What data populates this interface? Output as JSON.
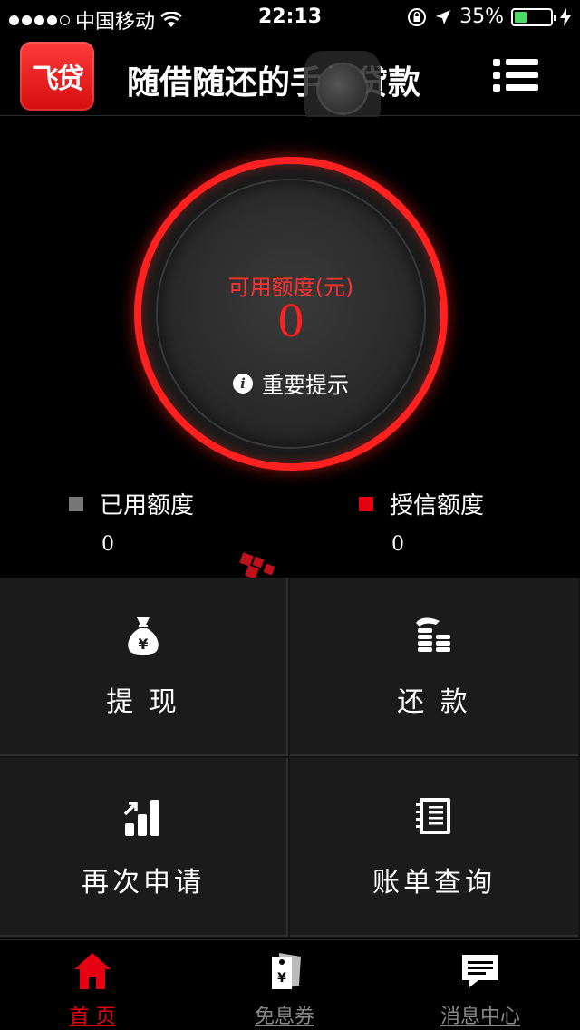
{
  "status_bar": {
    "carrier": "中国移动",
    "time": "22:13",
    "battery_percent": "35%",
    "battery_level": 0.35
  },
  "header": {
    "logo_text": "飞贷",
    "title": "随借随还的手机贷款",
    "menu_icon": "menu-icon"
  },
  "dial": {
    "label": "可用额度(元)",
    "value": "0",
    "tip": "重要提示",
    "tip_icon": "info-icon"
  },
  "legend": {
    "used": {
      "label": "已用额度",
      "value": "0",
      "color": "#777777"
    },
    "credit": {
      "label": "授信额度",
      "value": "0",
      "color": "#e60012"
    }
  },
  "actions": [
    {
      "label": "提 现",
      "icon": "money-bag-icon"
    },
    {
      "label": "还 款",
      "icon": "coin-stack-icon"
    },
    {
      "label": "再次申请",
      "icon": "bar-chart-up-icon"
    },
    {
      "label": "账单查询",
      "icon": "notebook-icon"
    }
  ],
  "tabbar": [
    {
      "label": "首 页",
      "icon": "home-icon",
      "active": true
    },
    {
      "label": "免息券",
      "icon": "coupon-tag-icon",
      "active": false
    },
    {
      "label": "消息中心",
      "icon": "message-icon",
      "active": false
    }
  ],
  "colors": {
    "accent": "#e60012",
    "dial_ring": "#ff2020",
    "background": "#000000",
    "tile": "#1b1b1b"
  }
}
